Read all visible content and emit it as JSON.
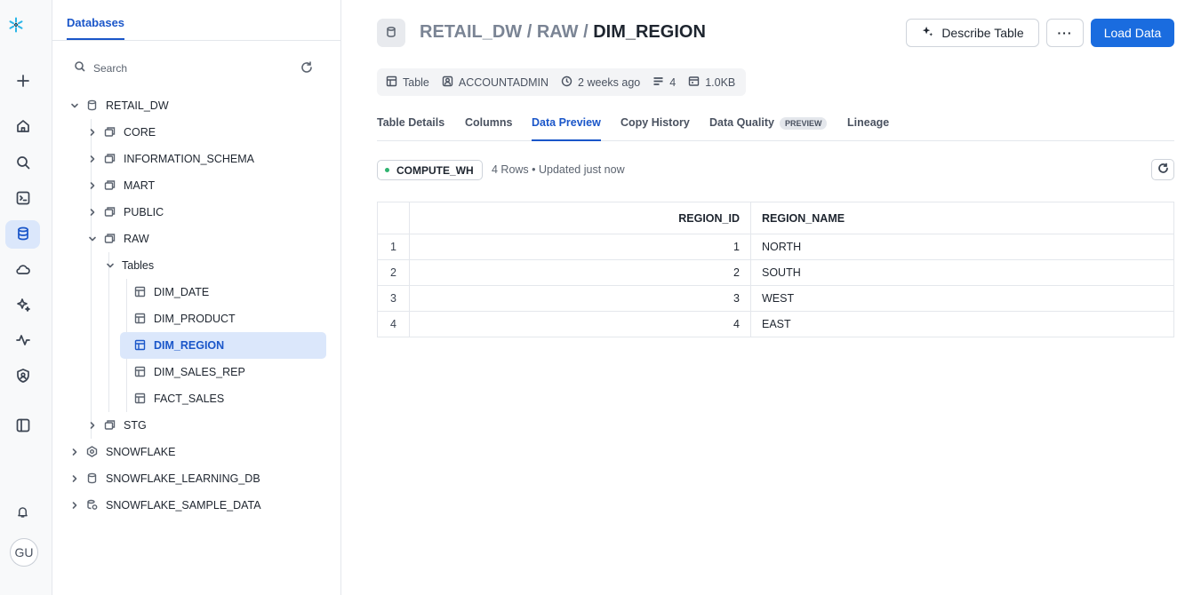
{
  "rail": {
    "avatar_initials": "GU",
    "items": [
      "create-icon",
      "home-icon",
      "search-icon",
      "terminal-icon",
      "database-icon",
      "cloud-icon",
      "sparkle-icon",
      "activity-icon",
      "shield-icon",
      "panel-icon",
      "bell-icon"
    ]
  },
  "explorer": {
    "tab_label": "Databases",
    "search_placeholder": "Search",
    "tree": {
      "retail_dw": "RETAIL_DW",
      "core": "CORE",
      "information_schema": "INFORMATION_SCHEMA",
      "mart": "MART",
      "public": "PUBLIC",
      "raw": "RAW",
      "tables": "Tables",
      "dim_date": "DIM_DATE",
      "dim_product": "DIM_PRODUCT",
      "dim_region": "DIM_REGION",
      "dim_sales_rep": "DIM_SALES_REP",
      "fact_sales": "FACT_SALES",
      "stg": "STG",
      "snowflake": "SNOWFLAKE",
      "snowflake_learning_db": "SNOWFLAKE_LEARNING_DB",
      "snowflake_sample_data": "SNOWFLAKE_SAMPLE_DATA"
    }
  },
  "header": {
    "crumb_db": "RETAIL_DW",
    "sep1": " / ",
    "crumb_schema": "RAW",
    "sep2": " / ",
    "crumb_table": "DIM_REGION",
    "describe_label": "Describe Table",
    "more_label": "···",
    "load_label": "Load Data"
  },
  "meta": {
    "type": "Table",
    "owner": "ACCOUNTADMIN",
    "updated": "2 weeks ago",
    "columns": "4",
    "size": "1.0KB"
  },
  "tabs": {
    "table_details": "Table Details",
    "columns": "Columns",
    "data_preview": "Data Preview",
    "copy_history": "Copy History",
    "data_quality": "Data Quality",
    "preview_badge": "PREVIEW",
    "lineage": "Lineage"
  },
  "preview": {
    "warehouse": "COMPUTE_WH",
    "rows_info": "4 Rows • Updated just now",
    "headers": [
      "REGION_ID",
      "REGION_NAME"
    ],
    "rows": [
      {
        "idx": "1",
        "region_id": "1",
        "region_name": "NORTH"
      },
      {
        "idx": "2",
        "region_id": "2",
        "region_name": "SOUTH"
      },
      {
        "idx": "3",
        "region_id": "3",
        "region_name": "WEST"
      },
      {
        "idx": "4",
        "region_id": "4",
        "region_name": "EAST"
      }
    ]
  },
  "colors": {
    "accent": "#1a56c9",
    "primary_button": "#1a6cdf",
    "logo": "#29b5e8",
    "warehouse_dot": "#2fb36f"
  }
}
